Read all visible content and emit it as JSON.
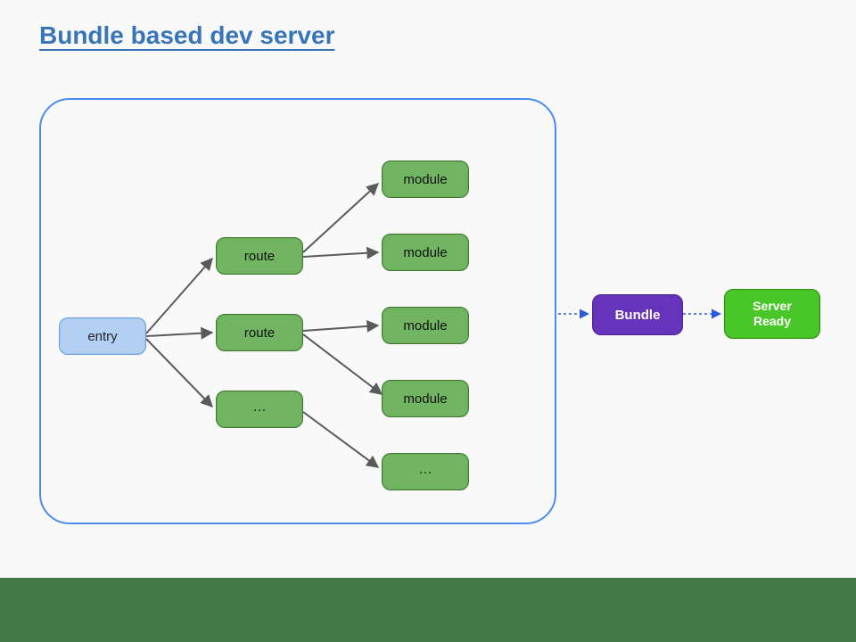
{
  "title": "Bundle based dev server",
  "nodes": {
    "entry": "entry",
    "route1": "route",
    "route2": "route",
    "route3": "···",
    "module1": "module",
    "module2": "module",
    "module3": "module",
    "module4": "module",
    "module5": "···",
    "bundle": "Bundle",
    "serverReady": "Server\nReady"
  },
  "colors": {
    "titleBlue": "#3874b8",
    "frameBlue": "#4b8cf0",
    "nodeBlueFill": "#b1d0f4",
    "nodeGreenFill": "#71b461",
    "nodePurpleFill": "#6633bb",
    "nodeBrightGreen": "#4ac728",
    "footerGreen": "#3f7a47",
    "arrowGray": "#5a5a5a",
    "arrowBlue": "#2b5bdc"
  }
}
